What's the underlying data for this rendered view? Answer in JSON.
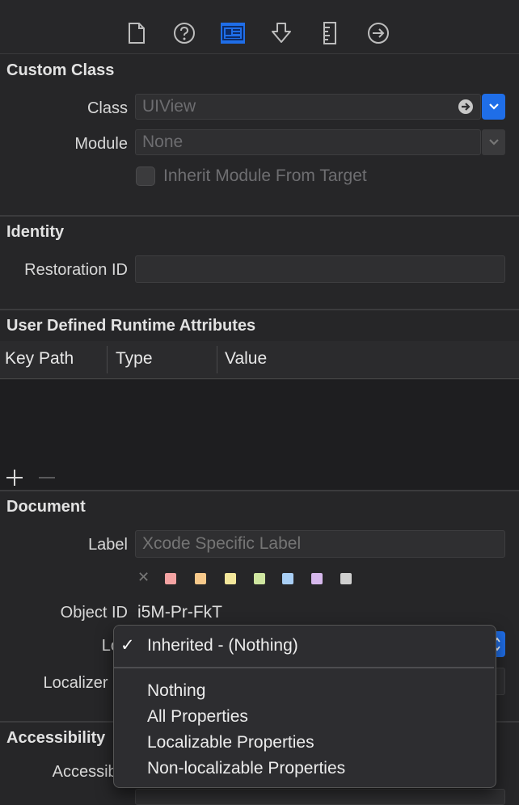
{
  "toolbar": {
    "icons": [
      "file-inspector-icon",
      "quick-help-icon",
      "identity-inspector-icon",
      "attributes-inspector-icon",
      "size-inspector-icon",
      "connections-inspector-icon"
    ]
  },
  "custom_class": {
    "title": "Custom Class",
    "class_label": "Class",
    "class_value": "UIView",
    "module_label": "Module",
    "module_value": "None",
    "inherit_label": "Inherit Module From Target"
  },
  "identity": {
    "title": "Identity",
    "restoration_label": "Restoration ID",
    "restoration_value": ""
  },
  "runtime_attrs": {
    "title": "User Defined Runtime Attributes",
    "columns": [
      "Key Path",
      "Type",
      "Value"
    ]
  },
  "document": {
    "title": "Document",
    "label_label": "Label",
    "label_placeholder": "Xcode Specific Label",
    "clear_glyph": "✕",
    "object_id_label": "Object ID",
    "object_id_value": "i5M-Pr-FkT",
    "lock_label": "Loc",
    "localizer_label": "Localizer Hi",
    "swatch_colors": [
      "#f4a3a3",
      "#f7c98b",
      "#f3e79b",
      "#cfe6a0",
      "#a9cff5",
      "#d6b8ec",
      "#cfcfcf"
    ]
  },
  "accessibility": {
    "title": "Accessibility",
    "accessibility_label": "Accessibili"
  },
  "menu": {
    "selected": "Inherited - (Nothing)",
    "check": "✓",
    "options": [
      "Nothing",
      "All Properties",
      "Localizable Properties",
      "Non-localizable Properties"
    ]
  },
  "colors": {
    "accent": "#1f6ee8",
    "background": "#262628"
  }
}
